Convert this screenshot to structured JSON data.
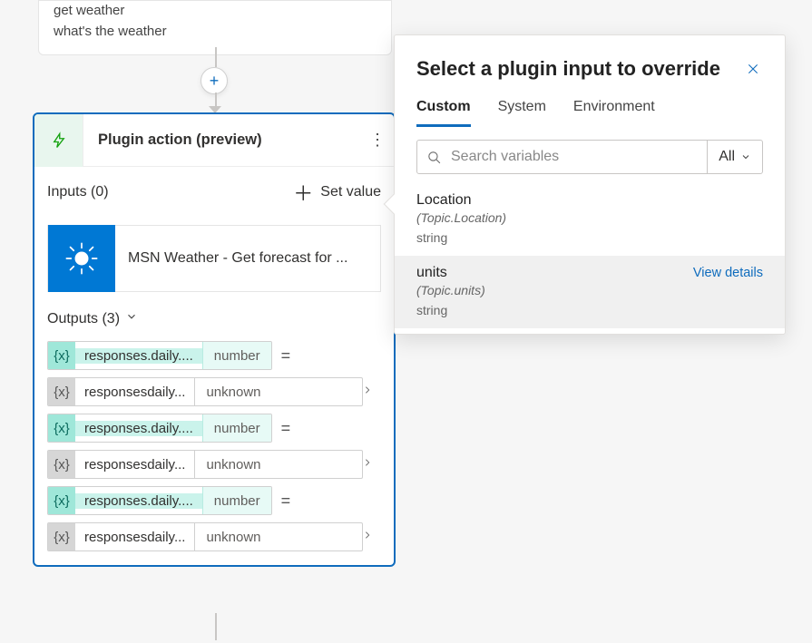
{
  "trigger": {
    "lines": [
      "get weather",
      "what's the weather"
    ]
  },
  "add_node_glyph": "+",
  "action": {
    "title": "Plugin action (preview)",
    "inputs_label": "Inputs (0)",
    "set_value_label": "Set value",
    "plugin_label": "MSN Weather - Get forecast for ...",
    "outputs_label": "Outputs (3)",
    "outputs": [
      {
        "style": "teal",
        "name": "responses.daily....",
        "type": "number",
        "equals": true
      },
      {
        "style": "gray",
        "name": "responsesdaily...",
        "type": "unknown",
        "equals": false
      },
      {
        "style": "teal",
        "name": "responses.daily....",
        "type": "number",
        "equals": true
      },
      {
        "style": "gray",
        "name": "responsesdaily...",
        "type": "unknown",
        "equals": false
      },
      {
        "style": "teal",
        "name": "responses.daily....",
        "type": "number",
        "equals": true
      },
      {
        "style": "gray",
        "name": "responsesdaily...",
        "type": "unknown",
        "equals": false
      }
    ]
  },
  "panel": {
    "title": "Select a plugin input to override",
    "tabs": {
      "custom": "Custom",
      "system": "System",
      "environment": "Environment"
    },
    "search_placeholder": "Search variables",
    "filter_label": "All",
    "variables": [
      {
        "name": "Location",
        "path": "(Topic.Location)",
        "type": "string",
        "selected": false
      },
      {
        "name": "units",
        "path": "(Topic.units)",
        "type": "string",
        "selected": true
      }
    ],
    "view_details_label": "View details"
  },
  "glyphs": {
    "var": "{x}",
    "equals": "=",
    "chevron_right": "›",
    "chevron_down": "⌄",
    "close": "✕",
    "more": "⋮"
  }
}
